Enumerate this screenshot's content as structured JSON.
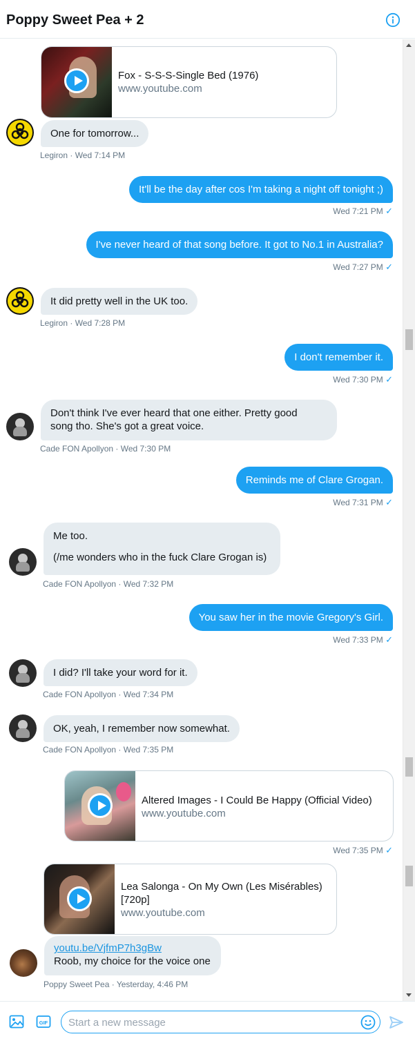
{
  "header": {
    "title": "Poppy Sweet Pea + 2",
    "info_icon": "info-icon"
  },
  "messages": {
    "m1_card_title": "Fox - S-S-S-Single Bed (1976)",
    "m1_card_domain": "www.youtube.com",
    "m2_text": "One for tomorrow...",
    "m2_meta": "Legiron · Wed 7:14 PM",
    "m3_text": "It'll be the day after cos I'm taking a night off tonight ;)",
    "m3_meta": "Wed 7:21 PM",
    "m4_text": "I've never heard of that song before. It got to No.1 in Australia?",
    "m4_meta": "Wed 7:27 PM",
    "m5_text": "It did pretty well in the UK too.",
    "m5_meta": "Legiron · Wed 7:28 PM",
    "m6_text": "I don't remember it.",
    "m6_meta": "Wed 7:30 PM",
    "m7_line1": "Don't think I've ever heard that one either. Pretty good",
    "m7_line2": "song tho. She's got a great voice.",
    "m7_meta": "Cade FON Apollyon · Wed 7:30 PM",
    "m8_text": "Reminds me of Clare Grogan.",
    "m8_meta": "Wed 7:31 PM",
    "m9_line1": "Me too.",
    "m9_line2": "(/me wonders who in the fuck Clare Grogan is)",
    "m9_meta": "Cade FON Apollyon · Wed 7:32 PM",
    "m10_text": "You saw her in the movie Gregory's Girl.",
    "m10_meta": "Wed 7:33 PM",
    "m11_text": "I did? I'll take your word for it.",
    "m11_meta": "Cade FON Apollyon · Wed 7:34 PM",
    "m12_text": "OK, yeah, I remember now somewhat.",
    "m12_meta": "Cade FON Apollyon · Wed 7:35 PM",
    "m13_card_title": "Altered Images - I Could Be Happy (Official Video)",
    "m13_card_domain": "www.youtube.com",
    "m13_meta": "Wed 7:35 PM",
    "m14_card_title1": "Lea Salonga - On My Own (Les Misérables)",
    "m14_card_title2": "[720p]",
    "m14_card_domain": "www.youtube.com",
    "m15_link": "youtu.be/VjfmP7h3gBw",
    "m15_text": "Roob, my choice for the voice one",
    "m15_meta": "Poppy Sweet Pea · Yesterday, 4:46 PM"
  },
  "check_mark": "✓",
  "composer": {
    "placeholder": "Start a new message",
    "media_icon": "image-icon",
    "gif_label": "GIF",
    "emoji_icon": "emoji-icon",
    "send_icon": "send-icon"
  },
  "colors": {
    "accent": "#1da1f2",
    "bubble_in": "#e6ecf0",
    "meta": "#657786"
  }
}
